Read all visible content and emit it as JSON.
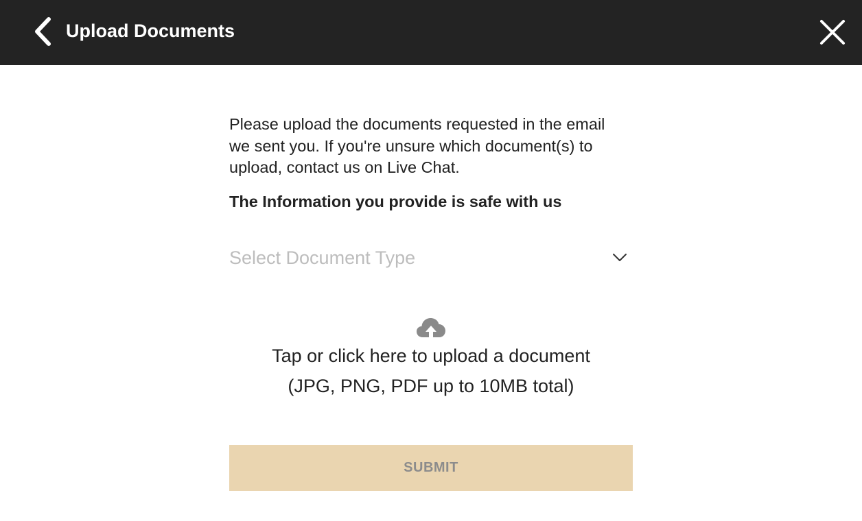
{
  "header": {
    "title": "Upload Documents",
    "back_icon": "chevron-left-icon",
    "close_icon": "close-icon",
    "background_color": "#232323"
  },
  "main": {
    "intro_text": "Please upload the documents requested in the email we sent you. If you're unsure which document(s) to upload, contact us on Live Chat.",
    "safe_note": "The Information you provide is safe with us",
    "document_type_select": {
      "placeholder": "Select Document Type",
      "icon": "chevron-down-icon"
    },
    "upload": {
      "icon": "cloud-upload-icon",
      "line1": "Tap or click here to upload a document",
      "line2": "(JPG, PNG, PDF up to 10MB total)"
    },
    "submit_label": "SUBMIT",
    "submit_color": "#ead5b0"
  }
}
